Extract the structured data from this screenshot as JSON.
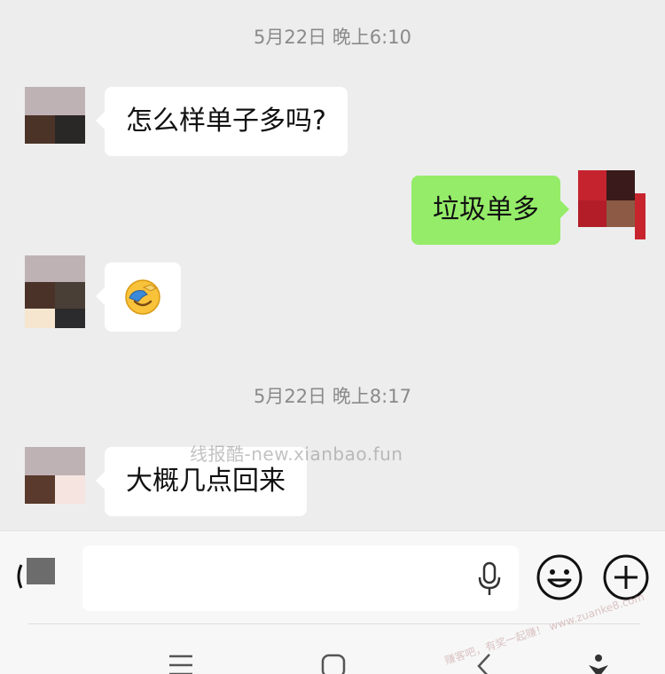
{
  "timestamps": [
    "5月22日 晚上6:10",
    "5月22日 晚上8:17"
  ],
  "messages": {
    "m1": "怎么样单子多吗?",
    "m2": "垃圾单多",
    "m4": "大概几点回来"
  },
  "watermark": "线报酷-new.xianbao.fun",
  "corner_watermark": "赚客吧，有奖一起赚！ www.zuanke8.com",
  "icons": {
    "emoji": "facepalm-emoji",
    "voice": "microphone-icon",
    "sticker": "smiley-icon",
    "more": "plus-icon"
  },
  "colors": {
    "background": "#ededed",
    "incoming_bubble": "#ffffff",
    "outgoing_bubble": "#95ec69",
    "timestamp": "#8a8a8a"
  }
}
